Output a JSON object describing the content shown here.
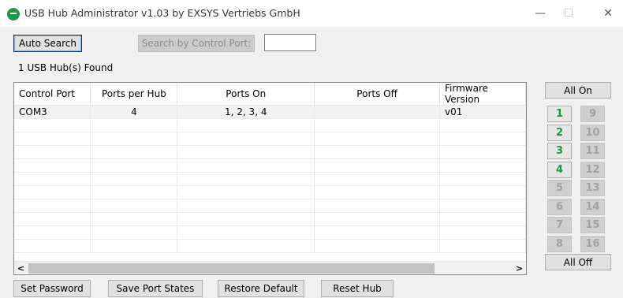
{
  "window": {
    "title": "USB Hub Administrator v1.03 by EXSYS Vertriebs GmbH",
    "minimize": "—",
    "maximize": "☐",
    "close": "✕"
  },
  "toolbar": {
    "auto_search": "Auto Search",
    "search_by_control_port": "Search by Control Port:",
    "control_port_value": ""
  },
  "status": {
    "found": "1 USB Hub(s) Found"
  },
  "table": {
    "headers": {
      "control_port": "Control Port",
      "ports_per_hub": "Ports per Hub",
      "ports_on": "Ports On",
      "ports_off": "Ports Off",
      "firmware_version": "Firmware Version"
    },
    "rows": [
      {
        "control_port": "COM3",
        "ports_per_hub": "4",
        "ports_on": "1, 2, 3, 4",
        "ports_off": "",
        "firmware_version": "v01"
      }
    ]
  },
  "scrollbar": {
    "left_arrow": "<",
    "right_arrow": ">"
  },
  "ports": {
    "all_on": "All On",
    "all_off": "All Off",
    "buttons": [
      {
        "label": "1",
        "state": "on"
      },
      {
        "label": "2",
        "state": "on"
      },
      {
        "label": "3",
        "state": "on"
      },
      {
        "label": "4",
        "state": "on"
      },
      {
        "label": "5",
        "state": "off"
      },
      {
        "label": "6",
        "state": "off"
      },
      {
        "label": "7",
        "state": "off"
      },
      {
        "label": "8",
        "state": "off"
      },
      {
        "label": "9",
        "state": "off"
      },
      {
        "label": "10",
        "state": "off"
      },
      {
        "label": "11",
        "state": "off"
      },
      {
        "label": "12",
        "state": "off"
      },
      {
        "label": "13",
        "state": "off"
      },
      {
        "label": "14",
        "state": "off"
      },
      {
        "label": "15",
        "state": "off"
      },
      {
        "label": "16",
        "state": "off"
      }
    ]
  },
  "footer": {
    "set_password": "Set Password",
    "save_port_states": "Save Port States",
    "restore_default": "Restore Default",
    "reset_hub": "Reset Hub"
  },
  "colors": {
    "port_on_text": "#139a43",
    "port_off_text": "#a2a2a2",
    "app_icon": "#1b9a4b"
  }
}
